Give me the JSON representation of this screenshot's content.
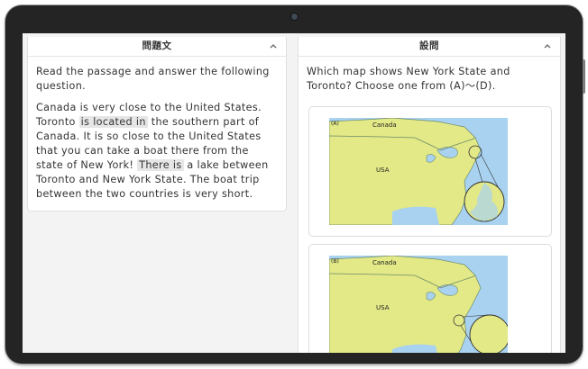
{
  "left_panel": {
    "title": "問題文",
    "instruction": "Read the passage and answer the following question.",
    "passage": {
      "p1": "Canada is very close to the United States. Toronto ",
      "hl1": "is located in",
      "p2": " the southern part of Canada. It is so close to the United States that you can take a boat there from the state of New York! ",
      "hl2": "There is",
      "p3": " a lake between Toronto and New York State. The boat trip between the two countries is very short."
    }
  },
  "right_panel": {
    "title": "設問",
    "question": "Which map shows New York State and Toronto? Choose one from (A)～(D).",
    "options": [
      {
        "label": "(A)",
        "canada": "Canada",
        "usa": "USA"
      },
      {
        "label": "(B)",
        "canada": "Canada",
        "usa": "USA"
      }
    ]
  },
  "colors": {
    "land": "#e3e987",
    "water": "#a8d2f0",
    "border": "#6c8a6a"
  }
}
